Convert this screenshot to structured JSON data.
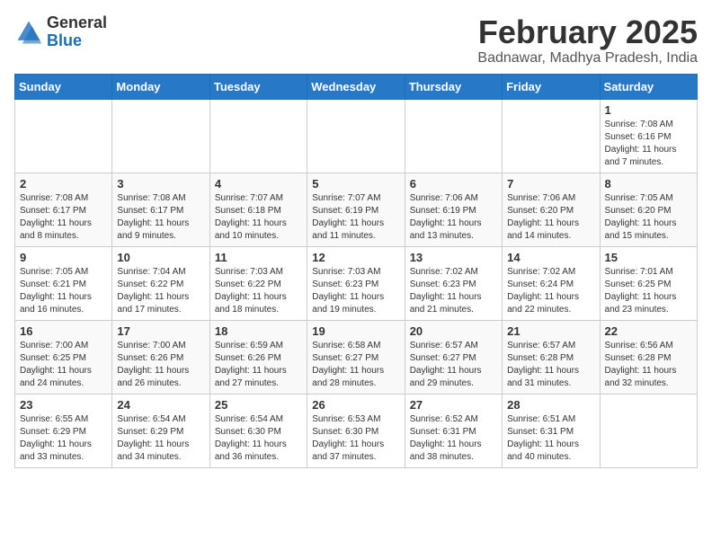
{
  "header": {
    "logo_general": "General",
    "logo_blue": "Blue",
    "month_title": "February 2025",
    "location": "Badnawar, Madhya Pradesh, India"
  },
  "weekdays": [
    "Sunday",
    "Monday",
    "Tuesday",
    "Wednesday",
    "Thursday",
    "Friday",
    "Saturday"
  ],
  "weeks": [
    [
      {
        "day": "",
        "info": ""
      },
      {
        "day": "",
        "info": ""
      },
      {
        "day": "",
        "info": ""
      },
      {
        "day": "",
        "info": ""
      },
      {
        "day": "",
        "info": ""
      },
      {
        "day": "",
        "info": ""
      },
      {
        "day": "1",
        "info": "Sunrise: 7:08 AM\nSunset: 6:16 PM\nDaylight: 11 hours\nand 7 minutes."
      }
    ],
    [
      {
        "day": "2",
        "info": "Sunrise: 7:08 AM\nSunset: 6:17 PM\nDaylight: 11 hours\nand 8 minutes."
      },
      {
        "day": "3",
        "info": "Sunrise: 7:08 AM\nSunset: 6:17 PM\nDaylight: 11 hours\nand 9 minutes."
      },
      {
        "day": "4",
        "info": "Sunrise: 7:07 AM\nSunset: 6:18 PM\nDaylight: 11 hours\nand 10 minutes."
      },
      {
        "day": "5",
        "info": "Sunrise: 7:07 AM\nSunset: 6:19 PM\nDaylight: 11 hours\nand 11 minutes."
      },
      {
        "day": "6",
        "info": "Sunrise: 7:06 AM\nSunset: 6:19 PM\nDaylight: 11 hours\nand 13 minutes."
      },
      {
        "day": "7",
        "info": "Sunrise: 7:06 AM\nSunset: 6:20 PM\nDaylight: 11 hours\nand 14 minutes."
      },
      {
        "day": "8",
        "info": "Sunrise: 7:05 AM\nSunset: 6:20 PM\nDaylight: 11 hours\nand 15 minutes."
      }
    ],
    [
      {
        "day": "9",
        "info": "Sunrise: 7:05 AM\nSunset: 6:21 PM\nDaylight: 11 hours\nand 16 minutes."
      },
      {
        "day": "10",
        "info": "Sunrise: 7:04 AM\nSunset: 6:22 PM\nDaylight: 11 hours\nand 17 minutes."
      },
      {
        "day": "11",
        "info": "Sunrise: 7:03 AM\nSunset: 6:22 PM\nDaylight: 11 hours\nand 18 minutes."
      },
      {
        "day": "12",
        "info": "Sunrise: 7:03 AM\nSunset: 6:23 PM\nDaylight: 11 hours\nand 19 minutes."
      },
      {
        "day": "13",
        "info": "Sunrise: 7:02 AM\nSunset: 6:23 PM\nDaylight: 11 hours\nand 21 minutes."
      },
      {
        "day": "14",
        "info": "Sunrise: 7:02 AM\nSunset: 6:24 PM\nDaylight: 11 hours\nand 22 minutes."
      },
      {
        "day": "15",
        "info": "Sunrise: 7:01 AM\nSunset: 6:25 PM\nDaylight: 11 hours\nand 23 minutes."
      }
    ],
    [
      {
        "day": "16",
        "info": "Sunrise: 7:00 AM\nSunset: 6:25 PM\nDaylight: 11 hours\nand 24 minutes."
      },
      {
        "day": "17",
        "info": "Sunrise: 7:00 AM\nSunset: 6:26 PM\nDaylight: 11 hours\nand 26 minutes."
      },
      {
        "day": "18",
        "info": "Sunrise: 6:59 AM\nSunset: 6:26 PM\nDaylight: 11 hours\nand 27 minutes."
      },
      {
        "day": "19",
        "info": "Sunrise: 6:58 AM\nSunset: 6:27 PM\nDaylight: 11 hours\nand 28 minutes."
      },
      {
        "day": "20",
        "info": "Sunrise: 6:57 AM\nSunset: 6:27 PM\nDaylight: 11 hours\nand 29 minutes."
      },
      {
        "day": "21",
        "info": "Sunrise: 6:57 AM\nSunset: 6:28 PM\nDaylight: 11 hours\nand 31 minutes."
      },
      {
        "day": "22",
        "info": "Sunrise: 6:56 AM\nSunset: 6:28 PM\nDaylight: 11 hours\nand 32 minutes."
      }
    ],
    [
      {
        "day": "23",
        "info": "Sunrise: 6:55 AM\nSunset: 6:29 PM\nDaylight: 11 hours\nand 33 minutes."
      },
      {
        "day": "24",
        "info": "Sunrise: 6:54 AM\nSunset: 6:29 PM\nDaylight: 11 hours\nand 34 minutes."
      },
      {
        "day": "25",
        "info": "Sunrise: 6:54 AM\nSunset: 6:30 PM\nDaylight: 11 hours\nand 36 minutes."
      },
      {
        "day": "26",
        "info": "Sunrise: 6:53 AM\nSunset: 6:30 PM\nDaylight: 11 hours\nand 37 minutes."
      },
      {
        "day": "27",
        "info": "Sunrise: 6:52 AM\nSunset: 6:31 PM\nDaylight: 11 hours\nand 38 minutes."
      },
      {
        "day": "28",
        "info": "Sunrise: 6:51 AM\nSunset: 6:31 PM\nDaylight: 11 hours\nand 40 minutes."
      },
      {
        "day": "",
        "info": ""
      }
    ]
  ]
}
